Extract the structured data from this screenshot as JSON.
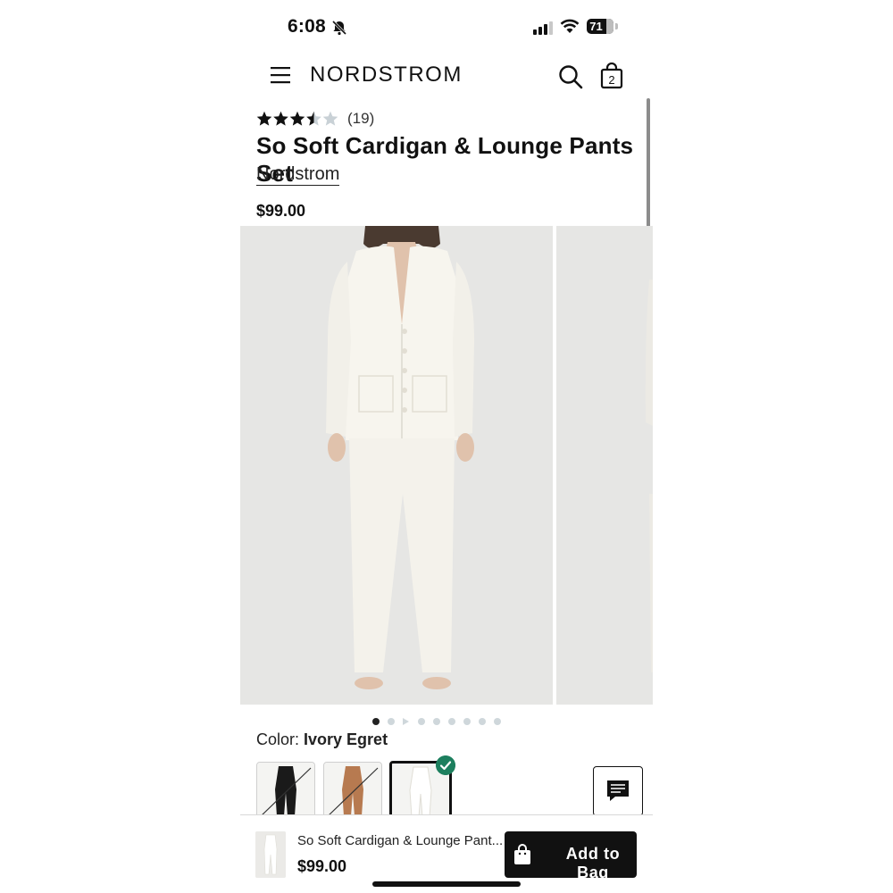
{
  "status_bar": {
    "time": "6:08",
    "battery": "71",
    "battery_level": 0.74
  },
  "header": {
    "brand": "NORDSTROM",
    "bag_count": "2"
  },
  "product": {
    "rating": 3.5,
    "review_count": "(19)",
    "title": "So Soft Cardigan & Lounge Pants Set",
    "brand": "Nordstrom",
    "price": "$99.00"
  },
  "gallery": {
    "image_count": 9,
    "active_index": 0
  },
  "color": {
    "label": "Color:",
    "value": "Ivory Egret"
  },
  "swatches": [
    {
      "name": "black",
      "available": false
    },
    {
      "name": "tan",
      "available": false
    },
    {
      "name": "ivory",
      "available": true,
      "selected": true
    }
  ],
  "bottom_bar": {
    "title": "So Soft Cardigan & Lounge Pant...",
    "price": "$99.00",
    "button_label": "Add to Bag"
  },
  "icons": [
    "bell-slash-icon",
    "signal-icon",
    "wifi-icon",
    "menu-icon",
    "search-icon",
    "shopping-bag-icon",
    "star-icon",
    "chat-icon",
    "check-icon"
  ],
  "colors": {
    "accent_green": "#1d7f5e",
    "button_black": "#111111",
    "photo_background": "#e6e6e4"
  }
}
